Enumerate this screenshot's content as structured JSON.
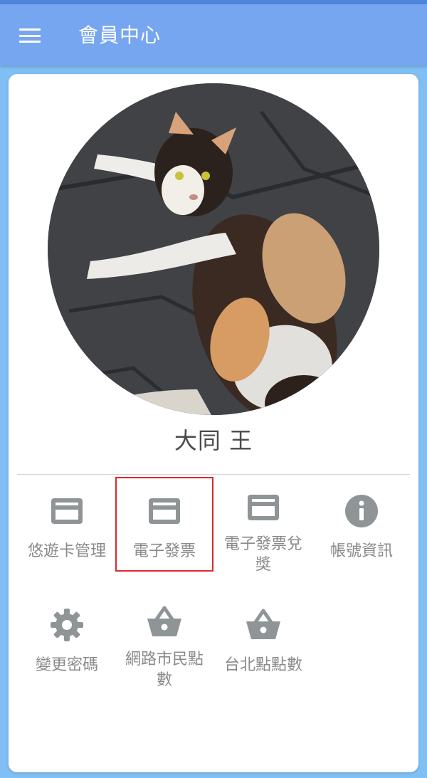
{
  "app": {
    "title": "會員中心",
    "colors": {
      "appbar": "#77a6f0",
      "background": "#7fbff3",
      "icon": "#8f9596",
      "highlight": "#e0262a"
    }
  },
  "profile": {
    "name": "大同 王",
    "avatar_desc": "cat-photo"
  },
  "menu": {
    "items": [
      {
        "label": "悠遊卡管理",
        "icon": "credit-card-icon"
      },
      {
        "label": "電子發票",
        "icon": "credit-card-icon",
        "selected": true
      },
      {
        "label": "電子發票兌獎",
        "icon": "credit-card-icon"
      },
      {
        "label": "帳號資訊",
        "icon": "info-icon"
      },
      {
        "label": "變更密碼",
        "icon": "gear-icon"
      },
      {
        "label": "網路市民點數",
        "icon": "basket-icon"
      },
      {
        "label": "台北點點數",
        "icon": "basket-icon"
      }
    ]
  }
}
